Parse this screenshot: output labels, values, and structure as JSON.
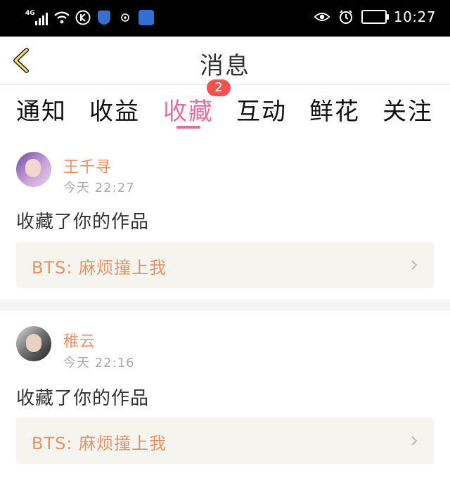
{
  "status_bar": {
    "network": "4G",
    "time": "10:27"
  },
  "header": {
    "title": "消息",
    "back_icon": "chevron-left-icon"
  },
  "tabs": [
    {
      "label": "通知"
    },
    {
      "label": "收益"
    },
    {
      "label": "收藏",
      "active": true,
      "badge": "2"
    },
    {
      "label": "互动"
    },
    {
      "label": "鲜花"
    },
    {
      "label": "关注"
    }
  ],
  "colors": {
    "accent": "#e070a0",
    "name": "#e3936a",
    "badge": "#f25252"
  },
  "messages": [
    {
      "user": "王千寻",
      "time": "今天 22:27",
      "action": "收藏了你的作品",
      "work": "BTS: 麻烦撞上我"
    },
    {
      "user": "稚云",
      "time": "今天 22:16",
      "action": "收藏了你的作品",
      "work": "BTS: 麻烦撞上我"
    }
  ]
}
